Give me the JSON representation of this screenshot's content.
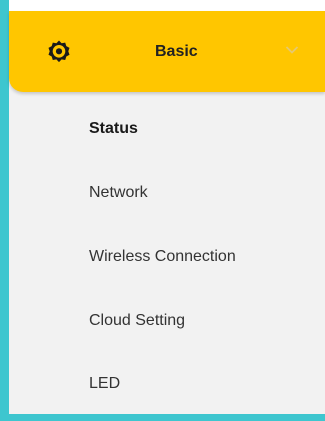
{
  "menu": {
    "header": {
      "label": "Basic",
      "icon": "gear-icon",
      "expand_icon": "chevron-down-icon",
      "background_color": "#ffc600"
    },
    "items": [
      {
        "label": "Status",
        "active": true
      },
      {
        "label": "Network",
        "active": false
      },
      {
        "label": "Wireless Connection",
        "active": false
      },
      {
        "label": "Cloud Setting",
        "active": false
      },
      {
        "label": "LED",
        "active": false
      }
    ]
  },
  "colors": {
    "accent": "#ffc600",
    "frame": "#3ec6cf",
    "menu_background": "#f2f2f2"
  }
}
